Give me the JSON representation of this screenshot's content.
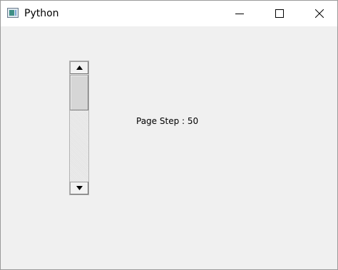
{
  "window": {
    "title": "Python",
    "controls": {
      "minimize": "minimize-icon",
      "maximize": "maximize-icon",
      "close": "close-icon"
    }
  },
  "scrollbar": {
    "orientation": "vertical",
    "position_fraction": 0.0
  },
  "label": {
    "text": "Page Step : 50"
  }
}
